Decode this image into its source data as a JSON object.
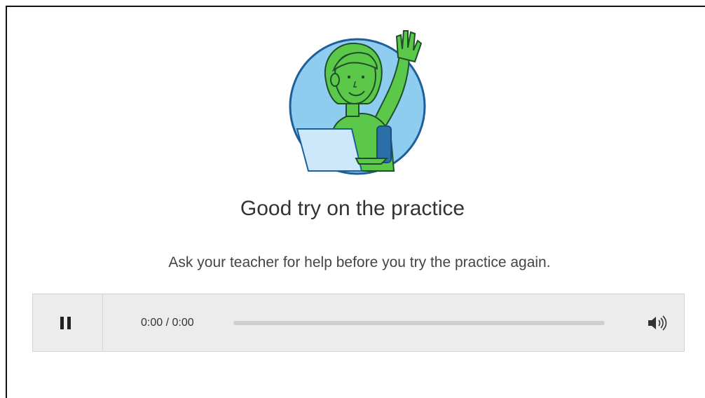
{
  "feedback": {
    "title": "Good try on the practice",
    "message": "Ask your teacher for help before you try the practice again."
  },
  "player": {
    "time_display": "0:00 / 0:00",
    "progress": 0,
    "pause_icon": "pause-icon",
    "volume_icon": "volume-icon"
  },
  "illustration": {
    "icon": "student-raising-hand-illustration"
  },
  "colors": {
    "circle_fill": "#8fcdf0",
    "circle_stroke": "#1f5f99",
    "figure": "#5cc84a",
    "player_bg": "#ececec",
    "text": "#333333"
  }
}
